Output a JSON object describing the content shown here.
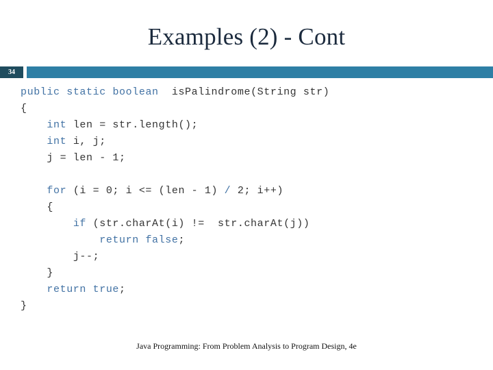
{
  "slide": {
    "title": "Examples (2) - Cont",
    "page_number": "34",
    "footer": "Java Programming: From Problem Analysis to Program Design, 4e",
    "colors": {
      "title_text": "#1b2a3d",
      "accent_bar": "#2e7fa5",
      "badge_background": "#1f4c5e",
      "badge_text": "#ffffff",
      "code_keyword": "#4272a4",
      "code_plain": "#343434",
      "background": "#ffffff"
    }
  },
  "code": {
    "language": "java",
    "lines": [
      {
        "indent": "",
        "tokens": [
          {
            "t": "public",
            "k": true
          },
          {
            "t": " ",
            "k": false
          },
          {
            "t": "static",
            "k": true
          },
          {
            "t": " ",
            "k": false
          },
          {
            "t": "boolean",
            "k": true
          },
          {
            "t": "  isPalindrome(String str)",
            "k": false
          }
        ]
      },
      {
        "indent": "",
        "tokens": [
          {
            "t": "{",
            "k": false
          }
        ]
      },
      {
        "indent": "    ",
        "tokens": [
          {
            "t": "int",
            "k": true
          },
          {
            "t": " len = str.length();",
            "k": false
          }
        ]
      },
      {
        "indent": "    ",
        "tokens": [
          {
            "t": "int",
            "k": true
          },
          {
            "t": " i, j;",
            "k": false
          }
        ]
      },
      {
        "indent": "    ",
        "tokens": [
          {
            "t": "j = len - 1;",
            "k": false
          }
        ]
      },
      {
        "indent": "",
        "tokens": []
      },
      {
        "indent": "    ",
        "tokens": [
          {
            "t": "for",
            "k": true
          },
          {
            "t": " (i = 0; i <= (len - 1) ",
            "k": false
          },
          {
            "t": "/",
            "k": true
          },
          {
            "t": " 2; i++)",
            "k": false
          }
        ]
      },
      {
        "indent": "    ",
        "tokens": [
          {
            "t": "{",
            "k": false
          }
        ]
      },
      {
        "indent": "        ",
        "tokens": [
          {
            "t": "if",
            "k": true
          },
          {
            "t": " (str.charAt(i) != ",
            "k": false
          },
          {
            "t": " str.charAt(j))",
            "k": false
          }
        ]
      },
      {
        "indent": "            ",
        "tokens": [
          {
            "t": "return",
            "k": true
          },
          {
            "t": " ",
            "k": false
          },
          {
            "t": "false",
            "k": true
          },
          {
            "t": ";",
            "k": false
          }
        ]
      },
      {
        "indent": "        ",
        "tokens": [
          {
            "t": "j--;",
            "k": false
          }
        ]
      },
      {
        "indent": "    ",
        "tokens": [
          {
            "t": "}",
            "k": false
          }
        ]
      },
      {
        "indent": "    ",
        "tokens": [
          {
            "t": "return",
            "k": true
          },
          {
            "t": " ",
            "k": false
          },
          {
            "t": "true",
            "k": true
          },
          {
            "t": ";",
            "k": false
          }
        ]
      },
      {
        "indent": "",
        "tokens": [
          {
            "t": "}",
            "k": false
          }
        ]
      }
    ],
    "plain_text": "public static  isPalindrome(String str)\n{\n    int len = str.length();\n    int i, j;\n    j = len - 1;\n\n    for (i = 0; i <= (len - 1) / 2; i++)\n    {\n        if (str.charAt(i) !=  str.charAt(j))\n            return false;\n        j--;\n    }\n    return true;\n}"
  }
}
